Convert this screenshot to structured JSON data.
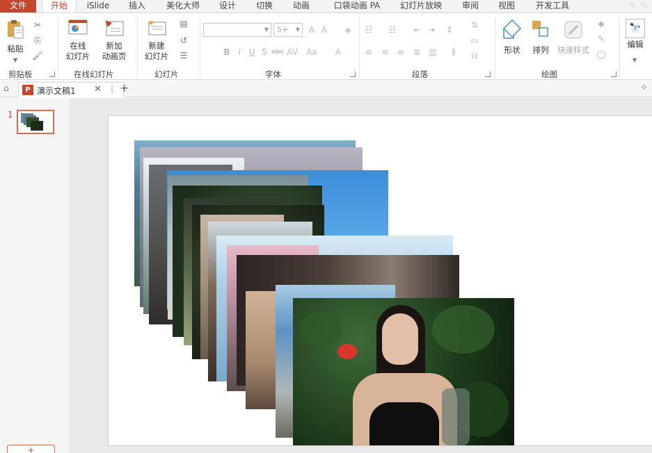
{
  "tabs": [
    "文件",
    "开始",
    "iSlide",
    "插入",
    "美化大师",
    "设计",
    "切换",
    "动画",
    "口袋动画 PA",
    "幻灯片放映",
    "审阅",
    "视图",
    "开发工具"
  ],
  "ribbon": {
    "clipboard": {
      "paste": "粘贴",
      "group": "剪贴板"
    },
    "online_slides": {
      "online": "在线\n幻灯片",
      "new_anim": "新加\n动画页",
      "group": "在线幻灯片"
    },
    "slides": {
      "new_slide": "新建\n幻灯片",
      "group": "幻灯片"
    },
    "font": {
      "size_value": "5+",
      "group": "字体"
    },
    "paragraph": {
      "group": "段落"
    },
    "drawing": {
      "shape": "形状",
      "arrange": "排列",
      "quick_style": "快速样式",
      "group": "绘图"
    },
    "editing": {
      "edit": "编辑"
    }
  },
  "document": {
    "title": "演示文稿1",
    "icon_letter": "P"
  },
  "slide_pane": {
    "slide_number": "1",
    "add_label": "+"
  },
  "colors": {
    "accent": "#c5452d",
    "thumb_border": "#d9694f"
  },
  "icons": [
    "paste-icon",
    "cut-icon",
    "copy-icon",
    "format-painter-icon",
    "online-slide-icon",
    "new-anim-page-icon",
    "new-slide-icon",
    "layout-icon",
    "reset-icon",
    "section-icon",
    "shape-icon",
    "arrange-icon",
    "quick-style-icon",
    "fill-icon",
    "outline-icon",
    "effect-icon",
    "find-icon"
  ]
}
